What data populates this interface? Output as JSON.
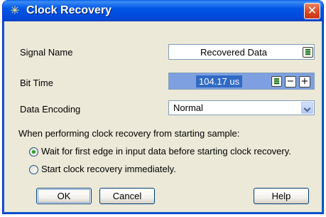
{
  "window": {
    "title": "Clock Recovery",
    "close_glyph": "✕"
  },
  "fields": {
    "signal_name_label": "Signal Name",
    "signal_name_value": "Recovered Data",
    "bit_time_label": "Bit Time",
    "bit_time_value": "104.17 us",
    "data_encoding_label": "Data Encoding",
    "data_encoding_value": "Normal"
  },
  "stepper": {
    "minus": "−",
    "plus": "+"
  },
  "recovery": {
    "prompt": "When performing clock recovery from starting sample:",
    "options": [
      {
        "label": "Wait for first edge in input data before starting clock recovery.",
        "selected": true
      },
      {
        "label": "Start clock recovery immediately.",
        "selected": false
      }
    ]
  },
  "buttons": {
    "ok": "OK",
    "cancel": "Cancel",
    "help": "Help"
  },
  "icons": {
    "title": "sparkle-icon",
    "calculator": "calculator-icon"
  },
  "colors": {
    "titlebar": "#0055e5",
    "selection": "#316ac5",
    "dialog_bg": "#ece9d8"
  }
}
